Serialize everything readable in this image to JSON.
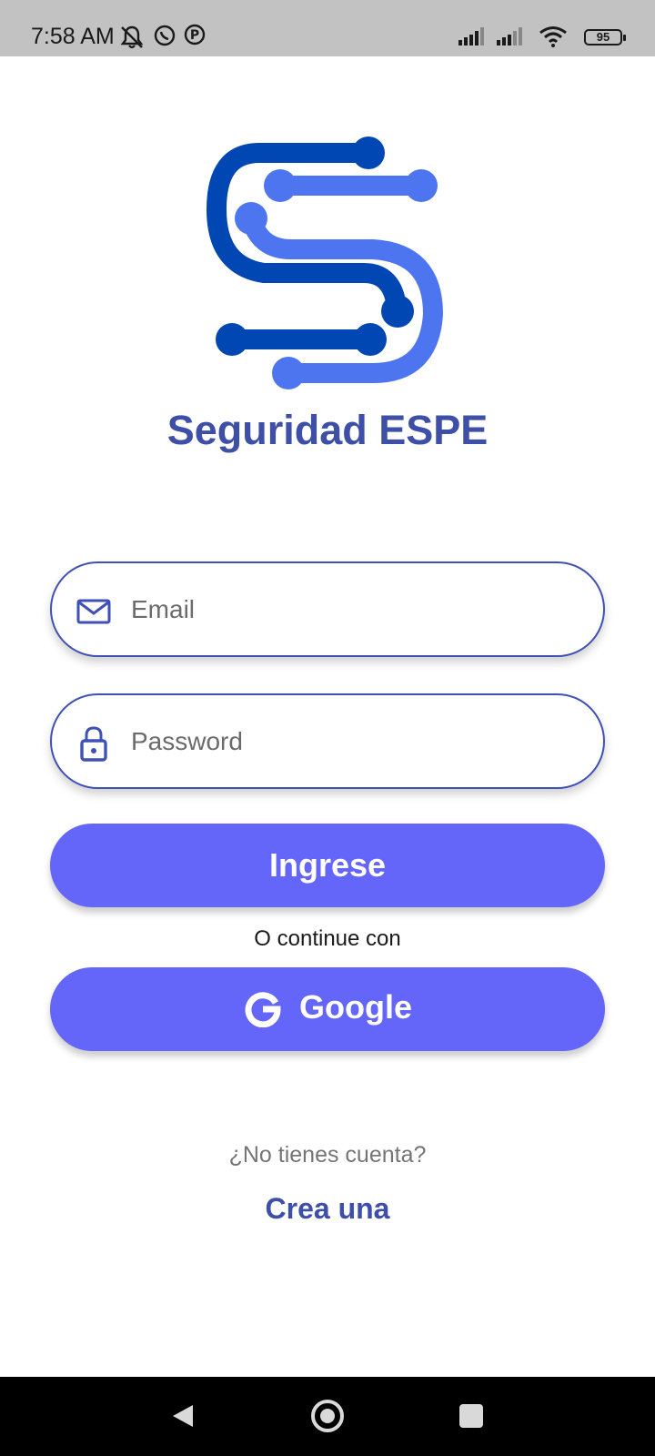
{
  "status_bar": {
    "time": "7:58 AM",
    "left_icons": [
      "muted-bell-icon",
      "whatsapp-icon",
      "pinterest-icon"
    ],
    "right_icons": [
      "signal-icon",
      "signal-icon",
      "wifi-icon",
      "battery-icon"
    ],
    "battery_level": "95"
  },
  "app": {
    "title": "Seguridad ESPE",
    "logo_colors": {
      "dark": "#0047b3",
      "light": "#4d75f0"
    }
  },
  "form": {
    "email": {
      "placeholder": "Email",
      "value": "",
      "icon": "mail-icon"
    },
    "password": {
      "placeholder": "Password",
      "value": "",
      "icon": "lock-icon"
    },
    "submit_label": "Ingrese",
    "divider_text": "O continue con",
    "google_label": "Google"
  },
  "footer": {
    "question": "¿No tienes cuenta?",
    "link": "Crea una"
  },
  "nav": [
    "back-icon",
    "home-icon",
    "recents-icon"
  ],
  "colors": {
    "accent": "#6366f8",
    "brand_text": "#3e4fa8",
    "field_border": "#3f51b5"
  }
}
